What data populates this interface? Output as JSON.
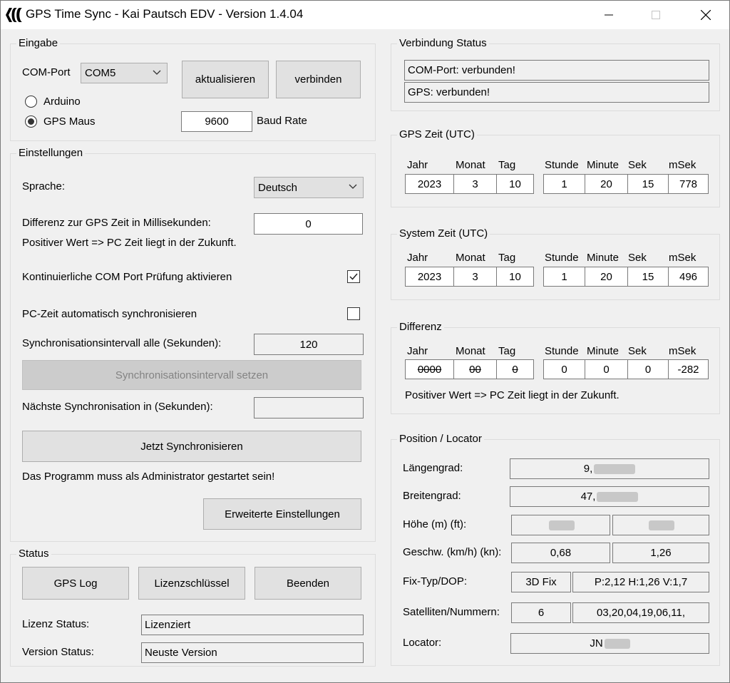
{
  "window": {
    "title": "GPS Time Sync - Kai Pautsch EDV - Version 1.4.04",
    "controls": [
      "minimize-icon",
      "maximize-icon",
      "close-icon"
    ]
  },
  "eingabe": {
    "group_label": "Eingabe",
    "comport_label": "COM-Port",
    "comport_value": "COM5",
    "refresh_button": "aktualisieren",
    "connect_button": "verbinden",
    "radio_arduino": "Arduino",
    "radio_gpsmaus": "GPS Maus",
    "radio_selected": "GPS Maus",
    "baud_value": "9600",
    "baud_label": "Baud Rate"
  },
  "einstellungen": {
    "group_label": "Einstellungen",
    "sprache_label": "Sprache:",
    "sprache_value": "Deutsch",
    "diff_label": "Differenz zur GPS Zeit in Millisekunden:",
    "diff_value": "0",
    "diff_hint": "Positiver Wert => PC Zeit liegt in der Zukunft.",
    "continuous_check_label": "Kontinuierliche COM Port Prüfung aktivieren",
    "continuous_check_checked": true,
    "auto_sync_label": "PC-Zeit automatisch synchronisieren",
    "auto_sync_checked": false,
    "interval_label": "Synchronisationsintervall alle (Sekunden):",
    "interval_value": "120",
    "set_interval_button": "Synchronisationsintervall setzen",
    "next_sync_label": "Nächste Synchronisation in (Sekunden):",
    "next_sync_value": "",
    "sync_now_button": "Jetzt Synchronisieren",
    "admin_note": "Das Programm muss als Administrator gestartet sein!",
    "advanced_button": "Erweiterte Einstellungen"
  },
  "status": {
    "group_label": "Status",
    "gps_log_button": "GPS Log",
    "license_key_button": "Lizenzschlüssel",
    "exit_button": "Beenden",
    "license_status_label": "Lizenz Status:",
    "license_status_value": "Lizenziert",
    "version_status_label": "Version Status:",
    "version_status_value": "Neuste Version"
  },
  "verbindung": {
    "group_label": "Verbindung Status",
    "comport_status": "COM-Port: verbunden!",
    "gps_status": "GPS: verbunden!"
  },
  "time_headers": {
    "jahr": "Jahr",
    "monat": "Monat",
    "tag": "Tag",
    "stunde": "Stunde",
    "minute": "Minute",
    "sek": "Sek",
    "msek": "mSek"
  },
  "gps_zeit": {
    "group_label": "GPS Zeit (UTC)",
    "jahr": "2023",
    "monat": "3",
    "tag": "10",
    "stunde": "1",
    "minute": "20",
    "sek": "15",
    "msek": "778"
  },
  "system_zeit": {
    "group_label": "System Zeit (UTC)",
    "jahr": "2023",
    "monat": "3",
    "tag": "10",
    "stunde": "1",
    "minute": "20",
    "sek": "15",
    "msek": "496"
  },
  "differenz": {
    "group_label": "Differenz",
    "jahr": "0000",
    "monat": "00",
    "tag": "0",
    "stunde": "0",
    "minute": "0",
    "sek": "0",
    "msek": "-282",
    "hint": "Positiver Wert => PC Zeit liegt in der Zukunft."
  },
  "position": {
    "group_label": "Position / Locator",
    "laengengrad_label": "Längengrad:",
    "laengengrad_value": "9,",
    "breitengrad_label": "Breitengrad:",
    "breitengrad_value": "47,",
    "hoehe_label": "Höhe (m) (ft):",
    "geschw_label": "Geschw. (km/h) (kn):",
    "geschw_kmh": "0,68",
    "geschw_kn": "1,26",
    "fix_label": "Fix-Typ/DOP:",
    "fix_value": "3D Fix",
    "dop_value": "P:2,12 H:1,26 V:1,7",
    "satelliten_label": "Satelliten/Nummern:",
    "satelliten_count": "6",
    "satelliten_numbers": "03,20,04,19,06,11,",
    "locator_label": "Locator:",
    "locator_value": "JN"
  }
}
